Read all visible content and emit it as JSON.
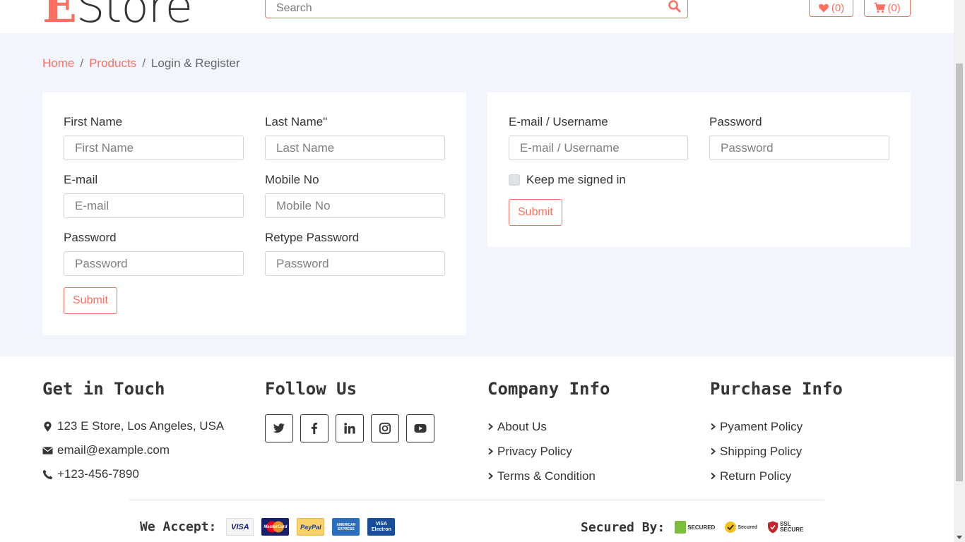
{
  "header": {
    "logo_first": "E",
    "logo_rest": "Store",
    "search_placeholder": "Search",
    "wishlist_count": "(0)",
    "cart_count": "(0)"
  },
  "breadcrumb": {
    "items": [
      "Home",
      "Products",
      "Login & Register"
    ],
    "separator": "/"
  },
  "register_form": {
    "first_name_label": "First Name",
    "first_name_placeholder": "First Name",
    "last_name_label": "Last Name\"",
    "last_name_placeholder": "Last Name",
    "email_label": "E-mail",
    "email_placeholder": "E-mail",
    "mobile_label": "Mobile No",
    "mobile_placeholder": "Mobile No",
    "password_label": "Password",
    "password_placeholder": "Password",
    "retype_label": "Retype Password",
    "retype_placeholder": "Password",
    "submit_label": "Submit"
  },
  "login_form": {
    "email_label": "E-mail / Username",
    "email_placeholder": "E-mail / Username",
    "password_label": "Password",
    "password_placeholder": "Password",
    "keep_signed_in_label": "Keep me signed in",
    "submit_label": "Submit"
  },
  "footer": {
    "contact": {
      "title": "Get in Touch",
      "address": "123 E Store, Los Angeles, USA",
      "email": "email@example.com",
      "phone": "+123-456-7890"
    },
    "follow": {
      "title": "Follow Us",
      "icons": [
        "twitter-icon",
        "facebook-icon",
        "linkedin-icon",
        "instagram-icon",
        "youtube-icon"
      ]
    },
    "company": {
      "title": "Company Info",
      "links": [
        "About Us",
        "Privacy Policy",
        "Terms & Condition"
      ]
    },
    "purchase": {
      "title": "Purchase Info",
      "links": [
        "Pyament Policy",
        "Shipping Policy",
        "Return Policy"
      ]
    },
    "accept_label": "We Accept:",
    "payment_cards": [
      "VISA",
      "MasterCard",
      "PayPal",
      "AMERICAN EXPRESS",
      "VISA Electron"
    ],
    "secured_label": "Secured By:",
    "security_badges": [
      "SECURED",
      "Secured",
      "SSL SECURE"
    ]
  },
  "colors": {
    "accent": "#ff6f61",
    "background": "#f2f5fd",
    "text": "#353535"
  }
}
